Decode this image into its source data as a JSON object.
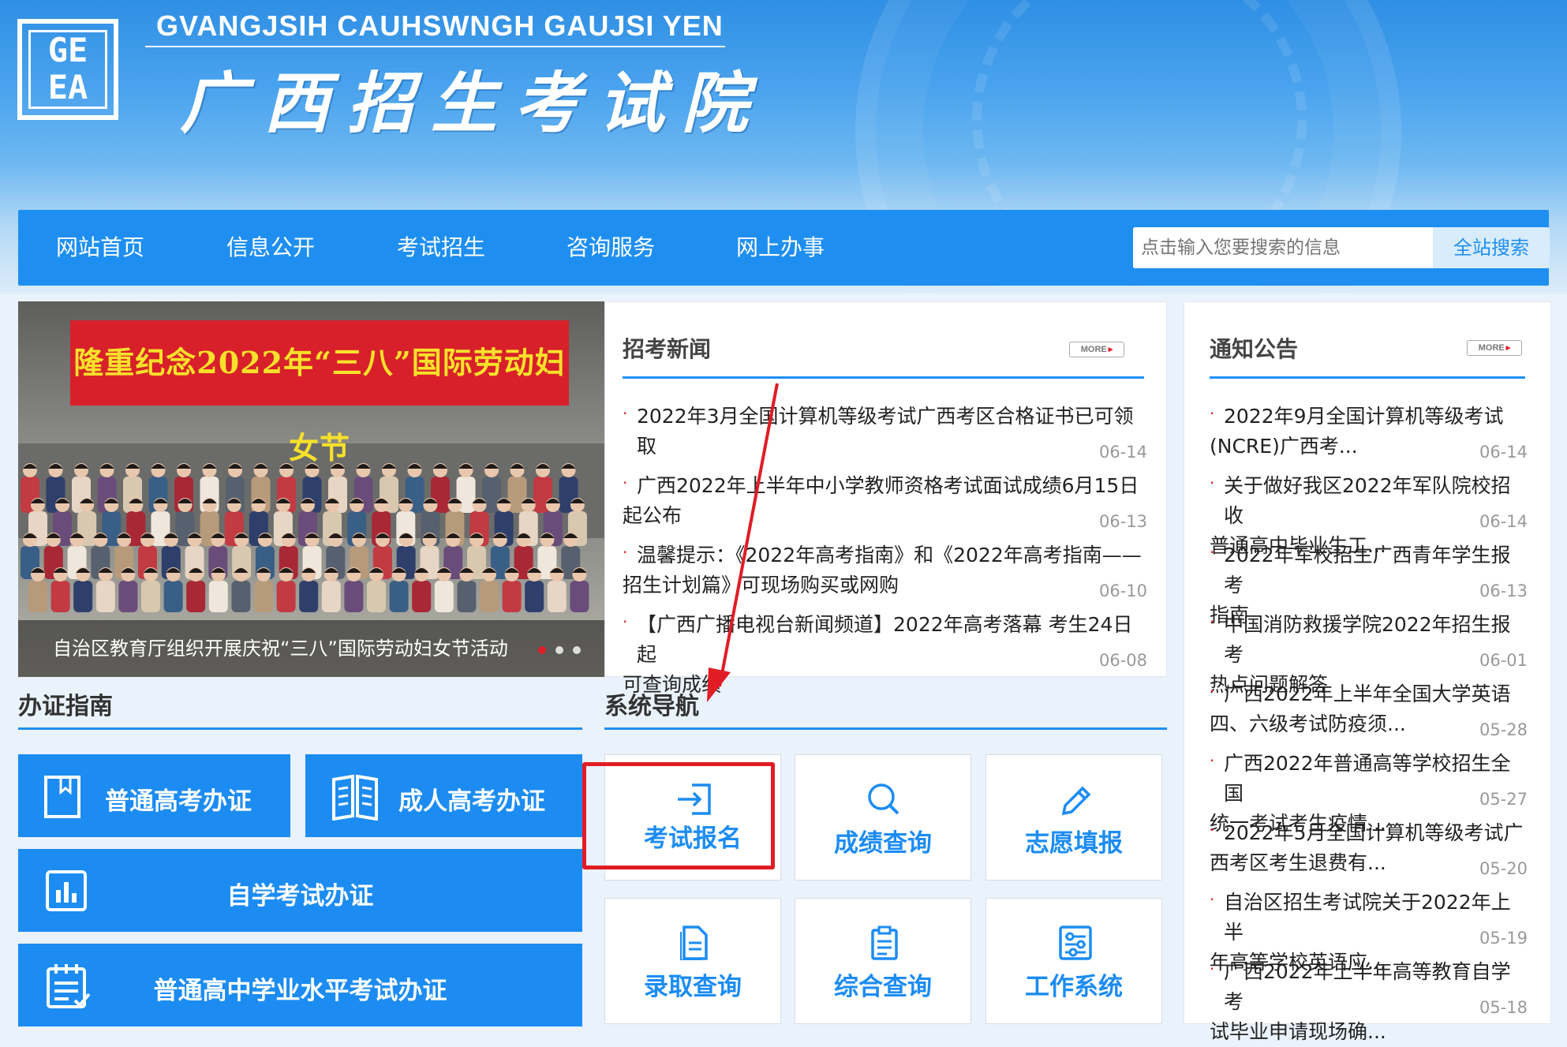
{
  "header": {
    "site_en": "GVANGJSIH CAUHSWNGH GAUJSI YEN",
    "site_cn": "广西招生考试院",
    "logo_letters": [
      "GE",
      "EA"
    ]
  },
  "nav": {
    "items": [
      "网站首页",
      "信息公开",
      "考试招生",
      "咨询服务",
      "网上办事"
    ],
    "search_placeholder": "点击输入您要搜索的信息",
    "search_button": "全站搜索"
  },
  "carousel": {
    "banner": "隆重纪念2022年“三八”国际劳动妇女节",
    "caption": "自治区教育厅组织开展庆祝“三八”国际劳动妇女节活动"
  },
  "news": {
    "title": "招考新闻",
    "more": "MORE",
    "items": [
      {
        "line1": "2022年3月全国计算机等级考试广西考区合格证书已可领取",
        "line2": "",
        "date": "06-14"
      },
      {
        "line1": "广西2022年上半年中小学教师资格考试面试成绩6月15日",
        "line2": "起公布",
        "date": "06-13"
      },
      {
        "line1": "温馨提示：《2022年高考指南》和《2022年高考指南——",
        "line2": "招生计划篇》可现场购买或网购",
        "date": "06-10"
      },
      {
        "line1": "【广西广播电视台新闻频道】2022年高考落幕 考生24日起",
        "line2": "可查询成绩",
        "date": "06-08"
      }
    ]
  },
  "notices": {
    "title": "通知公告",
    "more": "MORE",
    "items": [
      {
        "line1": "2022年9月全国计算机等级考试",
        "line2": "(NCRE)广西考...",
        "date": "06-14"
      },
      {
        "line1": "关于做好我区2022年军队院校招收",
        "line2": "普通高中毕业生工...",
        "date": "06-14"
      },
      {
        "line1": "2022年军校招生广西青年学生报考",
        "line2": "指南",
        "date": "06-13"
      },
      {
        "line1": "中国消防救援学院2022年招生报考",
        "line2": "热点问题解答",
        "date": "06-01"
      },
      {
        "line1": "广西2022年上半年全国大学英语",
        "line2": "四、六级考试防疫须...",
        "date": "05-28"
      },
      {
        "line1": "广西2022年普通高等学校招生全国",
        "line2": "统一考试考生疫情...",
        "date": "05-27"
      },
      {
        "line1": "2022年5月全国计算机等级考试广",
        "line2": "西考区考生退费有...",
        "date": "05-20"
      },
      {
        "line1": "自治区招生考试院关于2022年上半",
        "line2": "年高等学校英语应...",
        "date": "05-19"
      },
      {
        "line1": "广西2022年上半年高等教育自学考",
        "line2": "试毕业申请现场确...",
        "date": "05-18"
      }
    ]
  },
  "guide": {
    "title": "办证指南",
    "tiles": [
      "普通高考办证",
      "成人高考办证",
      "自学考试办证",
      "普通高中学业水平考试办证"
    ]
  },
  "sysnav": {
    "title": "系统导航",
    "cards": [
      "考试报名",
      "成绩查询",
      "志愿填报",
      "录取查询",
      "综合查询",
      "工作系统"
    ]
  },
  "colors": {
    "accent": "#1e8ff1",
    "highlight": "#e11c24"
  }
}
